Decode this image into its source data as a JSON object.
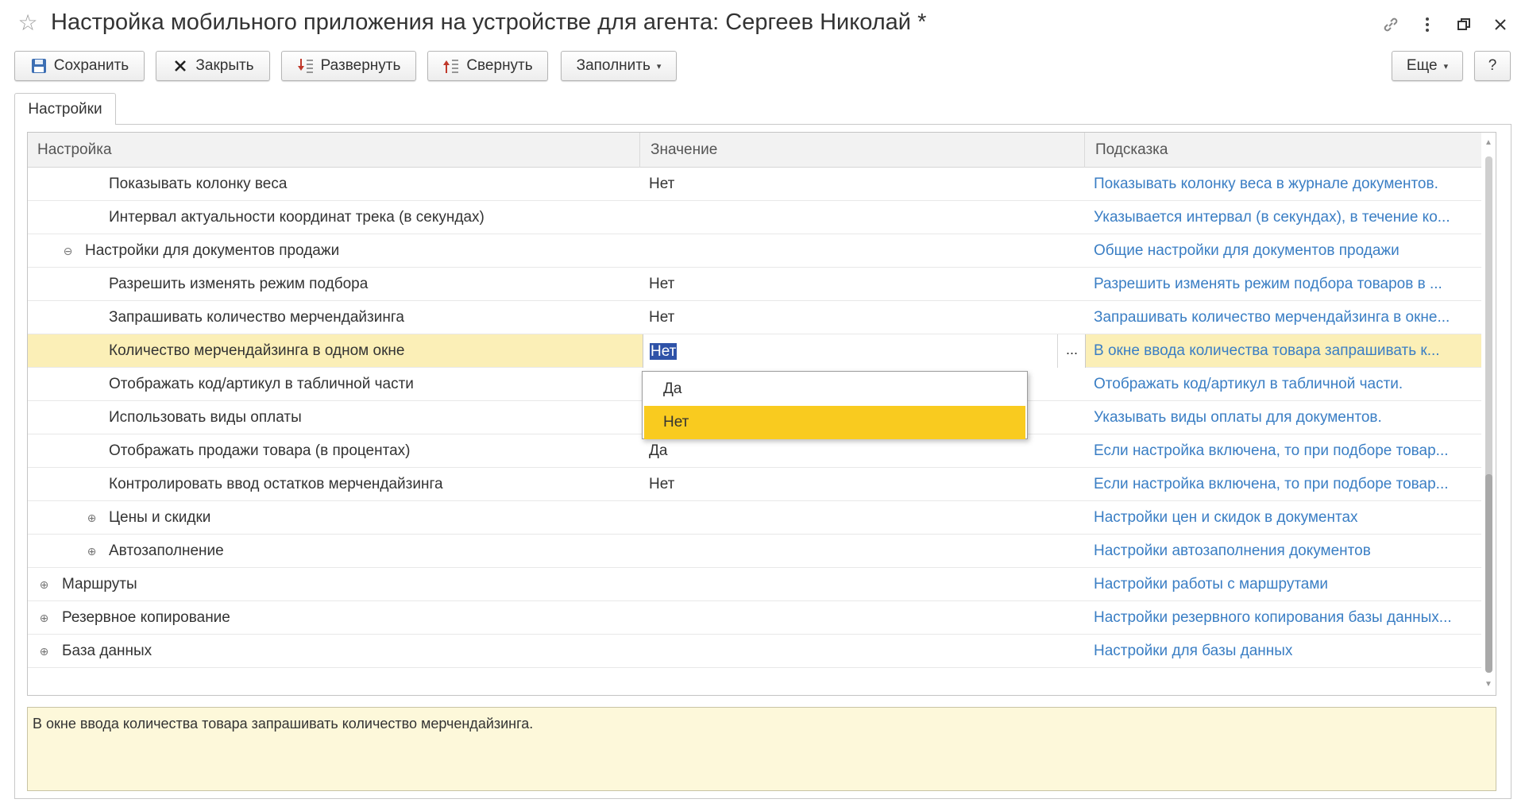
{
  "window": {
    "title": "Настройка мобильного приложения на устройстве для агента: Сергеев Николай *",
    "icons": [
      "star-icon",
      "link-icon",
      "more-vertical-icon",
      "restore-window-icon",
      "close-icon"
    ]
  },
  "toolbar": {
    "save_label": "Сохранить",
    "close_label": "Закрыть",
    "expand_label": "Развернуть",
    "collapse_label": "Свернуть",
    "fill_label": "Заполнить",
    "more_label": "Еще",
    "help_label": "?"
  },
  "tabs": [
    {
      "label": "Настройки"
    }
  ],
  "table": {
    "columns": {
      "setting": "Настройка",
      "value": "Значение",
      "hint": "Подсказка"
    },
    "rows": [
      {
        "setting": "Показывать колонку веса",
        "value": "Нет",
        "hint": "Показывать колонку веса в журнале документов."
      },
      {
        "setting": "Интервал актуальности координат трека (в секундах)",
        "value": "",
        "hint": "Указывается интервал (в секундах), в течение ко..."
      },
      {
        "setting": "Настройки для документов продажи",
        "value": "",
        "hint": "Общие настройки для документов продажи",
        "tree": "collapse"
      },
      {
        "setting": "Разрешить изменять режим подбора",
        "value": "Нет",
        "hint": "Разрешить изменять режим подбора товаров в ..."
      },
      {
        "setting": "Запрашивать количество мерчендайзинга",
        "value": "Нет",
        "hint": "Запрашивать количество мерчендайзинга в окне..."
      },
      {
        "setting": "Количество мерчендайзинга в одном окне",
        "value": "Нет",
        "hint": "В окне ввода количества товара запрашивать к...",
        "selected": true
      },
      {
        "setting": "Отображать код/артикул в табличной части",
        "value": "",
        "hint": "Отображать код/артикул в табличной части."
      },
      {
        "setting": "Использовать виды оплаты",
        "value": "",
        "hint": "Указывать виды оплаты для документов."
      },
      {
        "setting": "Отображать продажи товара (в процентах)",
        "value": "Да",
        "hint": "Если настройка включена, то при подборе товар..."
      },
      {
        "setting": "Контролировать ввод остатков мерчендайзинга",
        "value": "Нет",
        "hint": "Если настройка включена, то при подборе товар..."
      },
      {
        "setting": "Цены и скидки",
        "value": "",
        "hint": "Настройки цен и скидок в документах",
        "tree": "expand"
      },
      {
        "setting": "Автозаполнение",
        "value": "",
        "hint": "Настройки автозаполнения документов",
        "tree": "expand"
      },
      {
        "setting": "Маршруты",
        "value": "",
        "hint": "Настройки работы с маршрутами",
        "tree": "expand"
      },
      {
        "setting": "Резервное копирование",
        "value": "",
        "hint": "Настройки резервного копирования базы данных..."
      },
      {
        "setting": "База данных",
        "value": "",
        "hint": "Настройки для базы данных",
        "tree": "expand"
      }
    ]
  },
  "dropdown": {
    "options": [
      "Да",
      "Нет"
    ],
    "selected": "Нет"
  },
  "editor": {
    "ellipsis_label": "..."
  },
  "hint_panel": {
    "text": "В окне ввода количества товара запрашивать количество мерчендайзинга."
  }
}
